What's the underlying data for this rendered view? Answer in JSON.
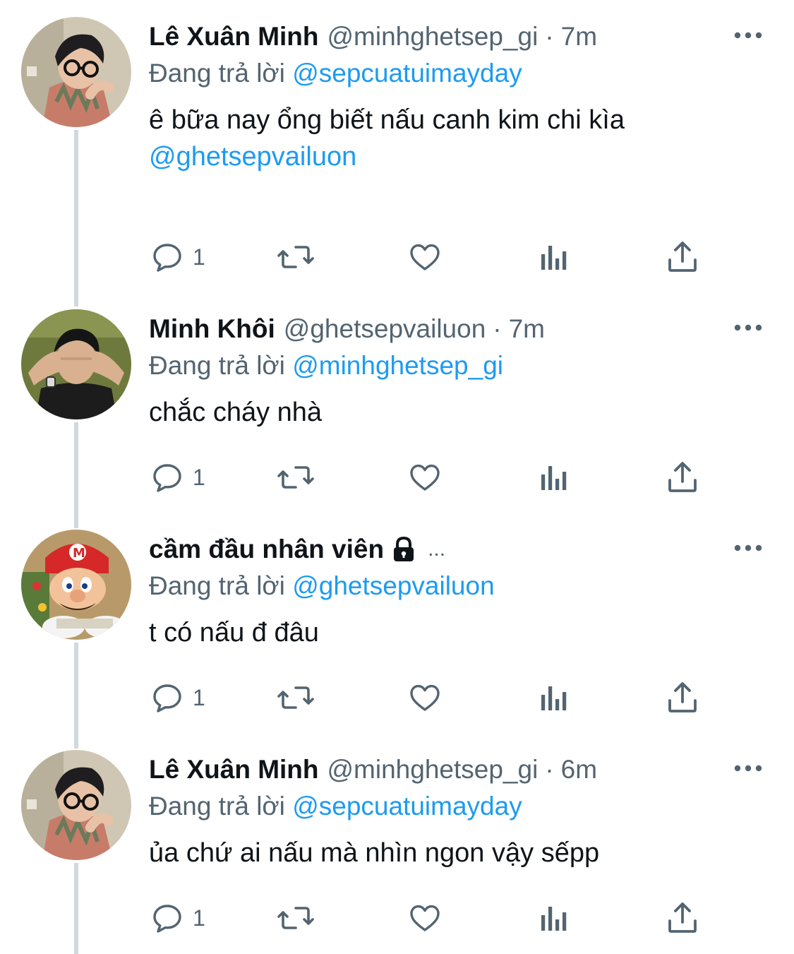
{
  "colors": {
    "accent": "#1d9bf0",
    "secondary_text": "#536471",
    "primary_text": "#0f1419",
    "thread_line": "#cfd9de"
  },
  "replying_label": "Đang trả lời",
  "tweets": [
    {
      "name": "Lê Xuân Minh",
      "handle": "@minhghetsep_gi",
      "dot": "·",
      "time": "7m",
      "replying_to": "@sepcuatuimayday",
      "text": "ê bữa nay ổng biết nấu canh kim chi kìa",
      "text_mention": "@ghetsepvailuon",
      "reply_count": "1",
      "icons": [
        "reply-icon",
        "retweet-icon",
        "like-icon",
        "views-icon",
        "share-icon"
      ]
    },
    {
      "name": "Minh Khôi",
      "handle": "@ghetsepvailuon",
      "dot": "·",
      "time": "7m",
      "replying_to": "@minhghetsep_gi",
      "text": "chắc cháy nhà",
      "reply_count": "1",
      "icons": [
        "reply-icon",
        "retweet-icon",
        "like-icon",
        "views-icon",
        "share-icon"
      ]
    },
    {
      "name": "cầm đầu nhân viên",
      "name_suffix": "...",
      "protected_icon": "lock-icon",
      "replying_to": "@ghetsepvailuon",
      "text": "t có nấu đ đâu",
      "reply_count": "1",
      "icons": [
        "reply-icon",
        "retweet-icon",
        "like-icon",
        "views-icon",
        "share-icon"
      ]
    },
    {
      "name": "Lê Xuân Minh",
      "handle": "@minhghetsep_gi",
      "dot": "·",
      "time": "6m",
      "replying_to": "@sepcuatuimayday",
      "text": "ủa chứ ai nấu mà nhìn ngon vậy sếpp",
      "reply_count": "1",
      "icons": [
        "reply-icon",
        "retweet-icon",
        "like-icon",
        "views-icon",
        "share-icon"
      ]
    }
  ]
}
